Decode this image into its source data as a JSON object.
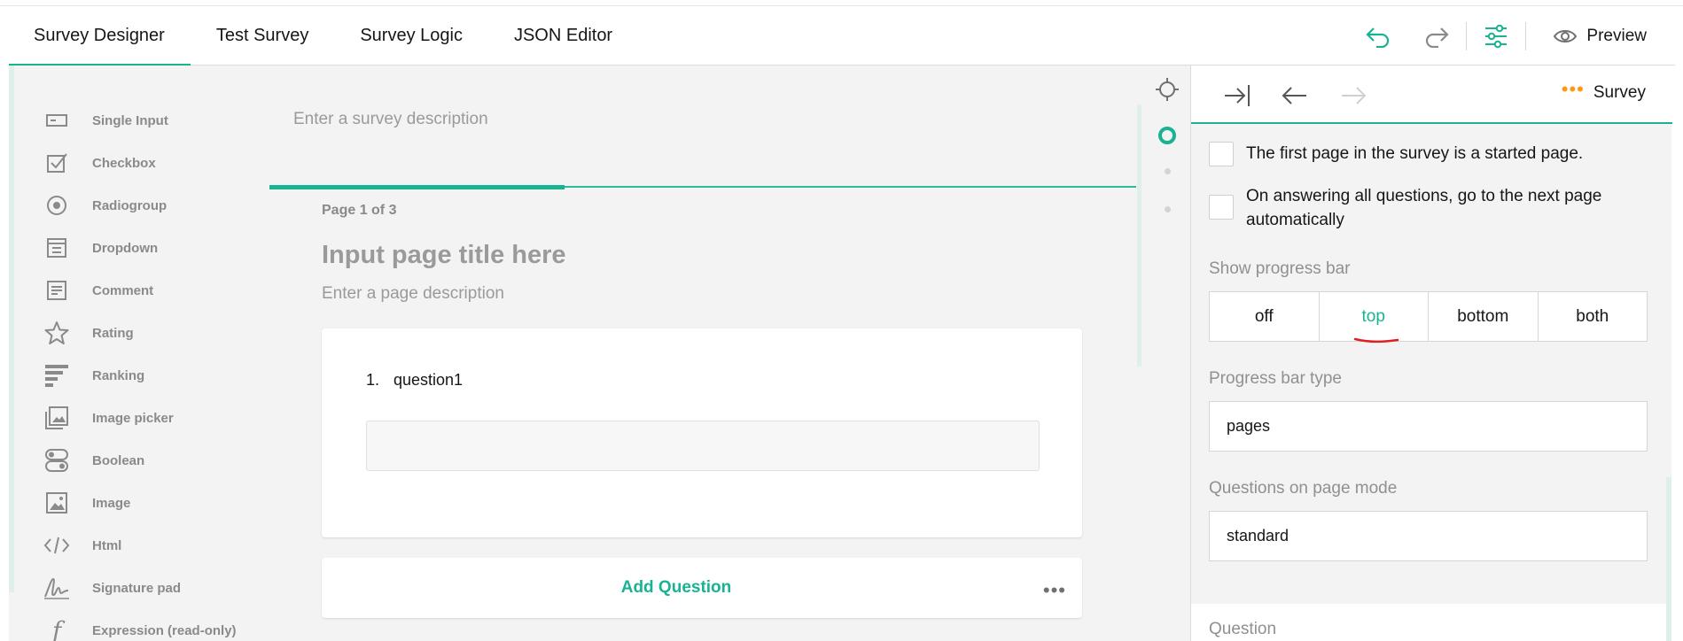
{
  "header": {
    "tabs": [
      {
        "label": "Survey Designer",
        "active": true
      },
      {
        "label": "Test Survey",
        "active": false
      },
      {
        "label": "Survey Logic",
        "active": false
      },
      {
        "label": "JSON Editor",
        "active": false
      }
    ],
    "toolbar": {
      "undo_icon": "undo-icon",
      "redo_icon": "redo-icon",
      "settings_icon": "settings-sliders-icon",
      "preview_label": "Preview"
    }
  },
  "toolbox": {
    "items": [
      {
        "label": "Single Input",
        "icon": "single-input-icon"
      },
      {
        "label": "Checkbox",
        "icon": "checkbox-icon"
      },
      {
        "label": "Radiogroup",
        "icon": "radiogroup-icon"
      },
      {
        "label": "Dropdown",
        "icon": "dropdown-icon"
      },
      {
        "label": "Comment",
        "icon": "comment-icon"
      },
      {
        "label": "Rating",
        "icon": "star-icon"
      },
      {
        "label": "Ranking",
        "icon": "ranking-icon"
      },
      {
        "label": "Image picker",
        "icon": "image-picker-icon"
      },
      {
        "label": "Boolean",
        "icon": "boolean-icon"
      },
      {
        "label": "Image",
        "icon": "image-icon"
      },
      {
        "label": "Html",
        "icon": "html-icon"
      },
      {
        "label": "Signature pad",
        "icon": "signature-icon"
      },
      {
        "label": "Expression (read-only)",
        "icon": "expression-icon"
      }
    ]
  },
  "designer": {
    "survey_description_placeholder": "Enter a survey description",
    "page_indicator": "Page 1 of 3",
    "progress": 0.34,
    "page_title_placeholder": "Input page title here",
    "page_description_placeholder": "Enter a page description",
    "question": {
      "number": "1.",
      "title": "question1"
    },
    "add_question_label": "Add Question",
    "more_label": "•••"
  },
  "panel": {
    "header_label": "Survey",
    "header_dots": "•••",
    "checkboxes": [
      {
        "label": "The first page in the survey is a started page.",
        "checked": false
      },
      {
        "label": "On answering all questions, go to the next page automatically",
        "checked": false
      }
    ],
    "progress_bar": {
      "label": "Show progress bar",
      "options": [
        "off",
        "top",
        "bottom",
        "both"
      ],
      "selected": "top"
    },
    "progress_bar_type": {
      "label": "Progress bar type",
      "value": "pages"
    },
    "questions_on_page_mode": {
      "label": "Questions on page mode",
      "value": "standard"
    },
    "next_section_label": "Question"
  },
  "colors": {
    "accent": "#19b394",
    "orange": "#ff9814",
    "annotation_red": "#e02020"
  }
}
